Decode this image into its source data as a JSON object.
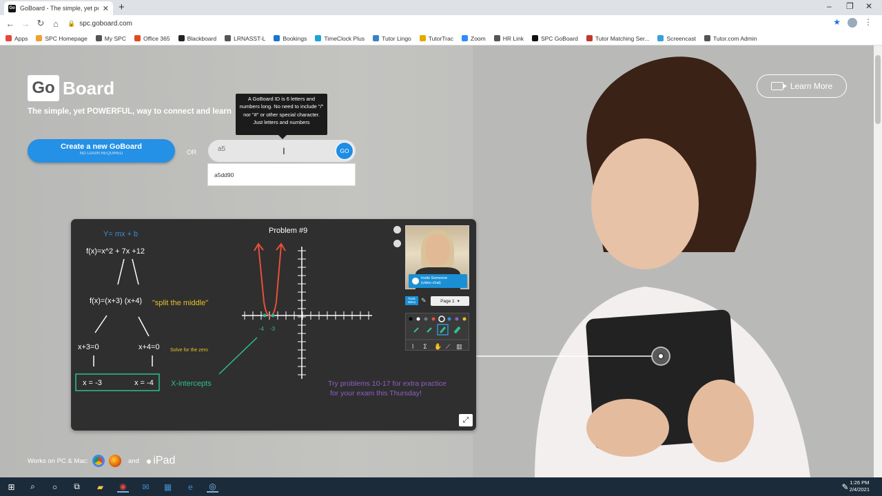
{
  "browser": {
    "tab_title": "GoBoard - The simple, yet powe",
    "favicon_text": "Go",
    "url": "spc.goboard.com"
  },
  "bookmarks": [
    {
      "label": "Apps",
      "color": "#e8453c"
    },
    {
      "label": "SPC Homepage",
      "color": "#f0a030"
    },
    {
      "label": "My SPC",
      "color": "#555555"
    },
    {
      "label": "Office 365",
      "color": "#e04a1f"
    },
    {
      "label": "Blackboard",
      "color": "#222222"
    },
    {
      "label": "LRNASST-L",
      "color": "#555555"
    },
    {
      "label": "Bookings",
      "color": "#1976d2"
    },
    {
      "label": "TimeClock Plus",
      "color": "#1ca3d8"
    },
    {
      "label": "Tutor Lingo",
      "color": "#3b82c4"
    },
    {
      "label": "TutorTrac",
      "color": "#e6a800"
    },
    {
      "label": "Zoom",
      "color": "#2d8cff"
    },
    {
      "label": "HR Link",
      "color": "#555555"
    },
    {
      "label": "SPC GoBoard",
      "color": "#111111"
    },
    {
      "label": "Tutor Matching Ser...",
      "color": "#c0392b"
    },
    {
      "label": "Screencast",
      "color": "#39a0d8"
    },
    {
      "label": "Tutor.com Admin",
      "color": "#555555"
    }
  ],
  "header": {
    "logo_box": "Go",
    "logo_text": "Board",
    "tagline": "The simple, yet POWERFUL, way to connect and learn",
    "learn_more": "Learn More"
  },
  "create": {
    "label": "Create a new GoBoard",
    "sublabel": "NO LOGIN REQUIRED"
  },
  "or_label": "OR",
  "join": {
    "value": "a5",
    "go_label": "GO",
    "tooltip": "A GoBoard ID is 6 letters and numbers long. No need to include \"/\" nor \"#\" or other special character. Just letters and numbers",
    "suggestion": "a5dd90"
  },
  "board": {
    "problem_title": "Problem #9",
    "line_eq": "Y= mx + b",
    "f1": "f(x)=x^2 + 7x +12",
    "f2": "f(x)=(x+3) (x+4)",
    "split": "\"split the middle\"",
    "eq1": "x+3=0",
    "eq2": "x+4=0",
    "solve": "Solve for the zero",
    "sol1": "x = -3",
    "sol2": "x = -4",
    "xint": "X-intercepts",
    "root1": "-4",
    "root2": "-3",
    "practice1": "Try problems 10-17 for extra practice",
    "practice2": "for your exam this Thursday!",
    "invite_title": "Invite Someone",
    "invite_sub": "(video chat)",
    "tools": "Tools Menu",
    "page_select": "Page 1",
    "colors": {
      "white": "#ffffff",
      "yellow": "#e6c229",
      "blue": "#3b8fd6",
      "green": "#2fbf8f",
      "red": "#e8503a",
      "purple": "#8e5fc4"
    }
  },
  "works": {
    "label": "Works on PC & Mac:",
    "and": "and",
    "ipad": "iPad"
  },
  "taskbar": {
    "time": "1:26 PM",
    "date": "2/4/2021"
  }
}
